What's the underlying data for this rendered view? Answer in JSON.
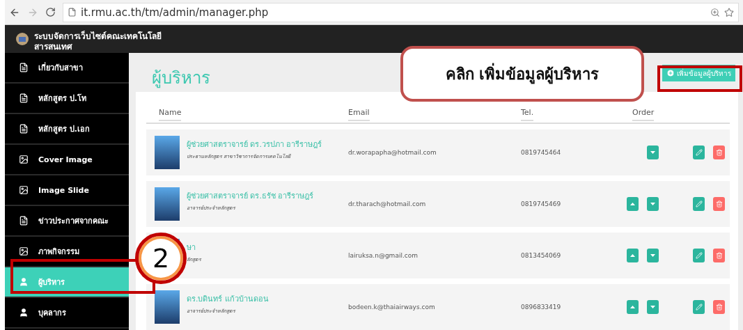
{
  "browser": {
    "url": "it.rmu.ac.th/tm/admin/manager.php"
  },
  "header": {
    "title_lines": [
      "ระบบจัดการเว็บไซต์คณะเทคโนโลยี",
      "สารสนเทศ"
    ]
  },
  "sidebar": {
    "items": [
      {
        "label": "เกี่ยวกับสาขา",
        "kind": "file",
        "selected": false
      },
      {
        "label": "หลักสูตร ป.โท",
        "kind": "file",
        "selected": false
      },
      {
        "label": "หลักสูตร ป.เอก",
        "kind": "file",
        "selected": false
      },
      {
        "label": "Cover Image",
        "kind": "image",
        "selected": false
      },
      {
        "label": "Image Slide",
        "kind": "image",
        "selected": false
      },
      {
        "label": "ข่าวประกาศจากคณะ",
        "kind": "file",
        "selected": false
      },
      {
        "label": "ภาพกิจกรรม",
        "kind": "image",
        "selected": false
      },
      {
        "label": "ผู้บริหาร",
        "kind": "user",
        "selected": true
      },
      {
        "label": "บุคลากร",
        "kind": "user",
        "selected": false
      }
    ]
  },
  "page_title": "ผู้บริหาร",
  "add_button": "เพิ่มข้อมูลผู้บริหาร",
  "table": {
    "columns": [
      "Name",
      "Email",
      "Tel.",
      "Order"
    ],
    "rows": [
      {
        "name": "ผู้ช่วยศาสตราจารย์ ดร.วรปภา อารีราษฎร์",
        "role": "ประธานหลักสูตร สาขาวิชาการจัดการเทคโนโลยี",
        "email": "dr.worapapha@hotmail.com",
        "tel": "0819745464",
        "can_move_up": false,
        "can_move_down": true
      },
      {
        "name": "ผู้ช่วยศาสตราจารย์ ดร.ธรัช อารีราษฎร์",
        "role": "อาจารย์ประจำหลักสูตร",
        "email": "dr.tharach@hotmail.com",
        "tel": "0819745469",
        "can_move_up": true,
        "can_move_down": true
      },
      {
        "name": "ษา",
        "role": "ลักสูตร",
        "email": "lairuksa.n@gmail.com",
        "tel": "0813454069",
        "can_move_up": true,
        "can_move_down": true
      },
      {
        "name": "ดร.บดินทร์ แก้วบ้านดอน",
        "role": "อาจารย์ประจำหลักสูตร",
        "email": "bodeen.k@thaiairways.com",
        "tel": "0896833419",
        "can_move_up": true,
        "can_move_down": true
      }
    ]
  },
  "annotations": {
    "callout_text": "คลิก เพิ่มข้อมูลผู้บริหาร",
    "step_number": "2"
  }
}
